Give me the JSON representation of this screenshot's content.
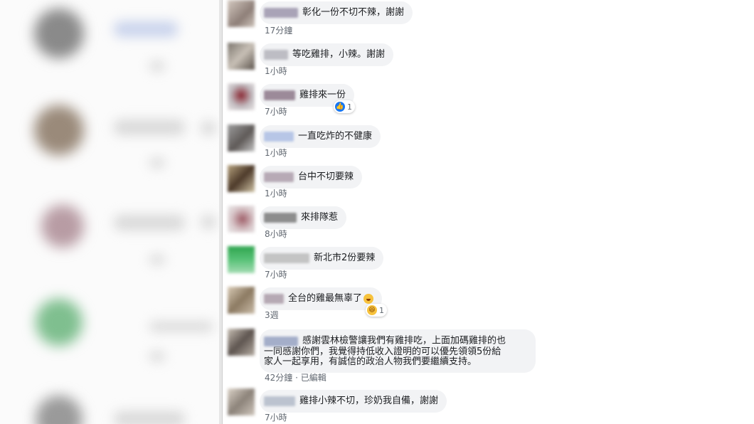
{
  "comments": [
    {
      "text": "彰化一份不切不辣，謝謝",
      "time": "17分鐘"
    },
    {
      "text": "等吃雞排，小辣。謝謝",
      "time": "1小時"
    },
    {
      "text": "雞排來一份",
      "time": "7小時",
      "reaction": {
        "icon": "like-icon",
        "count": "1"
      }
    },
    {
      "text": "一直吃炸的不健康",
      "time": "1小時"
    },
    {
      "text": "台中不切要辣",
      "time": "1小時"
    },
    {
      "text": "來排隊惹",
      "time": "8小時"
    },
    {
      "text": "新北市2份要辣",
      "time": "7小時"
    },
    {
      "text": "全台的雞最無辜了",
      "emoji": "laughing-emoji",
      "time": "3週",
      "reaction": {
        "icon": "haha-icon",
        "count": "1"
      }
    },
    {
      "lines": [
        "感謝雲林檢警讓我們有雞排吃，上面加碼雞排的也",
        "一同感謝你們，我覺得持低收入證明的可以優先領領5份給",
        "家人一起享用，有誠信的政治人物我們要繼續支持。"
      ],
      "time": "42分鐘",
      "edited": "已編輯"
    },
    {
      "text": "雞排小辣不切，珍奶我自備，謝謝",
      "time": "7小時"
    }
  ],
  "colors": {
    "bubble": "#f2f3f5",
    "meta": "#606770",
    "like": "#1877f2",
    "haha": "#f7c23c"
  }
}
